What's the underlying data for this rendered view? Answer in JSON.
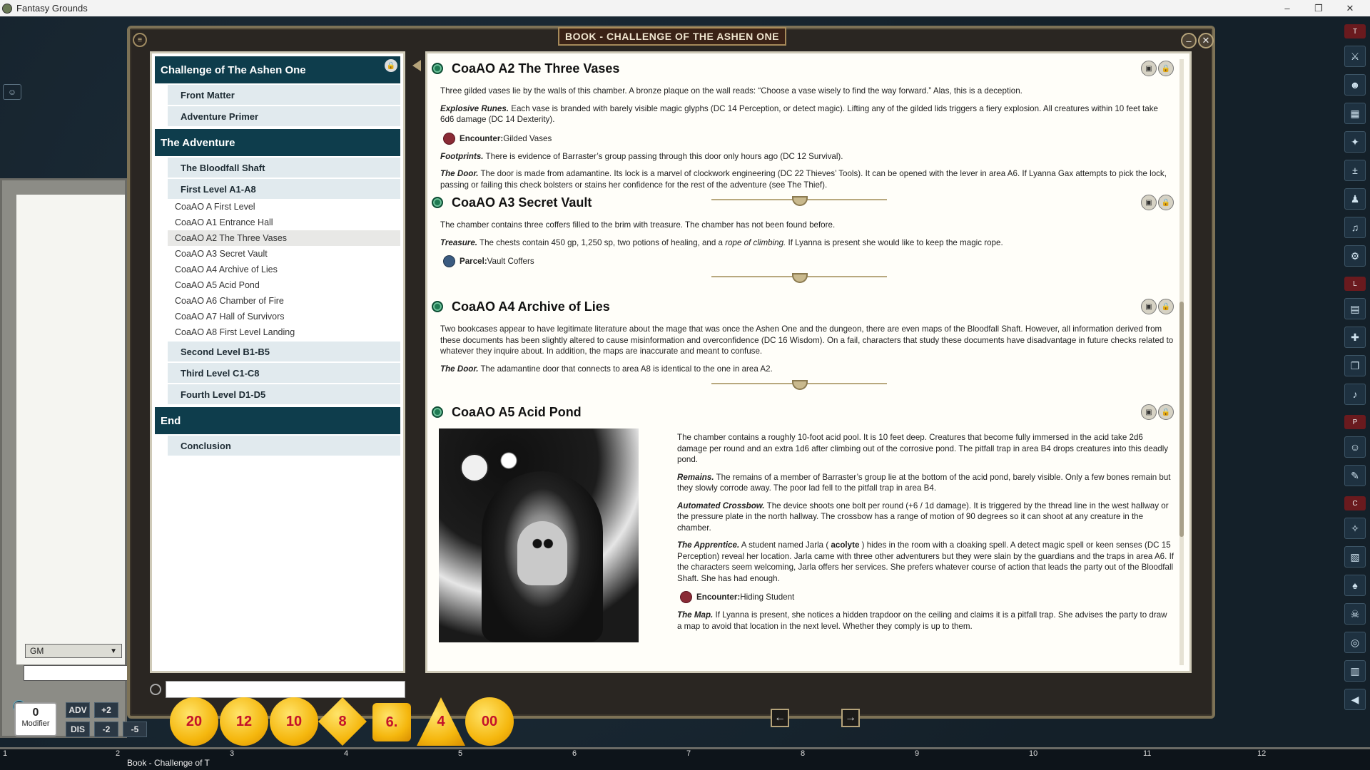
{
  "app": {
    "title": "Fantasy Grounds"
  },
  "window_controls": {
    "minimize": "–",
    "maximize": "❐",
    "close": "✕"
  },
  "book": {
    "header": "BOOK - CHALLENGE OF THE ASHEN ONE",
    "toc": {
      "sections": [
        {
          "title": "Challenge of The Ashen One",
          "chapters": [
            "Front Matter",
            "Adventure Primer"
          ]
        },
        {
          "title": "The Adventure",
          "chapters": [
            "The Bloodfall Shaft",
            "First Level A1-A8"
          ]
        },
        {
          "title": "End",
          "chapters": [
            "Conclusion"
          ]
        }
      ],
      "first_level_pages": [
        "CoaAO A First Level",
        "CoaAO A1 Entrance Hall",
        "CoaAO A2 The Three Vases",
        "CoaAO A3 Secret Vault",
        "CoaAO A4 Archive of Lies",
        "CoaAO A5 Acid Pond",
        "CoaAO A6 Chamber of Fire",
        "CoaAO A7 Hall of Survivors",
        "CoaAO A8 First Level Landing"
      ],
      "more_chapters": [
        "Second Level B1-B5",
        "Third Level C1-C8",
        "Fourth Level D1-D5"
      ],
      "selected": "CoaAO A2 The Three Vases"
    },
    "entries": {
      "a2": {
        "title": "CoaAO A2 The Three Vases",
        "p1": "Three gilded vases lie by the walls of this chamber. A bronze plaque on the wall reads: “Choose a vase wisely to find the way forward.” Alas, this is a deception.",
        "p2_label": "Explosive Runes.",
        "p2": " Each vase is branded with barely visible magic glyphs (DC 14 Perception, or detect magic). Lifting any of the gilded lids triggers a fiery explosion. All creatures within 10 feet take 6d6 damage (DC 14 Dexterity).",
        "link_label": "Encounter:",
        "link_value": " Gilded Vases",
        "p3_label": "Footprints.",
        "p3": " There is evidence of Barrastеr’s group passing through this door only hours ago (DC 12 Survival).",
        "p4_label": "The Door.",
        "p4": " The door is made from adamantine. Its lock is a marvel of clockwork engineering (DC 22 Thieves’ Tools). It can be opened with the lever in area A6. If Lyanna Gax attempts to pick the lock, passing or failing this check bolsters or stains her confidence for the rest of the adventure (see The Thief)."
      },
      "a3": {
        "title": "CoaAO A3 Secret Vault",
        "p1": "The chamber contains three coffers filled to the brim with treasure. The chamber has not been found before.",
        "p2_label": "Treasure.",
        "p2": " The chests contain 450 gp, 1,250 sp, two potions of healing, and a ",
        "p2_em": "rope of climbing.",
        "p2_end": " If Lyanna is present she would like to keep the magic rope.",
        "link_label": "Parcel:",
        "link_value": " Vault Coffers"
      },
      "a4": {
        "title": "CoaAO A4 Archive of Lies",
        "p1": "Two bookcases appear to have legitimate literature about the mage that was once the Ashen One and the dungeon, there are even maps of the Bloodfall Shaft. However, all information derived from these documents has been slightly altered to cause misinformation and overconfidence (DC 16 Wisdom). On a fail, characters that study these documents have disadvantage in future checks related to whatever they inquire about. In addition, the maps are inaccurate and meant to confuse.",
        "p2_label": "The Door.",
        "p2": " The adamantine door that connects to area A8 is identical to the one in area A2."
      },
      "a5": {
        "title": "CoaAO A5 Acid Pond",
        "p1": "The chamber contains a roughly 10-foot acid pool. It is 10 feet deep. Creatures that become fully immersed in the acid take 2d6 damage per round and an extra 1d6 after climbing out of the corrosive pond. The pitfall trap in area B4 drops creatures into this deadly pond.",
        "p2_label": "Remains.",
        "p2": " The remains of a member of Barraster’s group lie at the bottom of the acid pond, barely visible. Only a few bones remain but they slowly corrode away. The poor lad fell to the pitfall trap in area B4.",
        "p3_label": "Automated Crossbow.",
        "p3": " The device shoots one bolt per round (+6 / 1d damage). It is triggered by the thread line in the west hallway or the pressure plate in the north hallway. The crossbow has a range of motion of 90 degrees so it can shoot at any creature in the chamber.",
        "p4_label": "The Apprentice.",
        "p4": " A student named Jarla ( ",
        "p4_b": "acolyte",
        "p4_end": " ) hides in the room with a cloaking spell. A detect magic spell or keen senses (DC 15 Perception) reveal her location. Jarla came with three other adventurers but they were slain by the guardians and the traps in area A6. If the characters seem welcoming, Jarla offers her services. She prefers whatever course of action that leads the party out of the Bloodfall Shaft. She has had enough.",
        "link_label": "Encounter:",
        "link_value": " Hiding Student",
        "p5_label": "The Map.",
        "p5": " If Lyanna is present, she notices a hidden trapdoor on the ceiling and claims it is a pitfall trap. She advises the party to draw a map to avoid that location in the next level. Whether they comply is up to them."
      }
    },
    "nav": {
      "prev": "←",
      "next": "→"
    }
  },
  "chat": {
    "speaker": "GM"
  },
  "dice_bar": {
    "modifier_value": "0",
    "modifier_label": "Modifier",
    "buttons": [
      "ADV",
      "+2",
      "DIS",
      "-2",
      "-5"
    ],
    "dice": [
      "20",
      "12",
      "10",
      "8",
      "6.",
      "4",
      "00"
    ]
  },
  "right_toolbar": {
    "tabs": [
      "T",
      "L",
      "P",
      "C"
    ]
  },
  "hotbar": {
    "numbers": [
      "1",
      "2",
      "3",
      "4",
      "5",
      "6",
      "7",
      "8",
      "9",
      "10",
      "11",
      "12"
    ],
    "active_label": "Book - Challenge of T"
  }
}
